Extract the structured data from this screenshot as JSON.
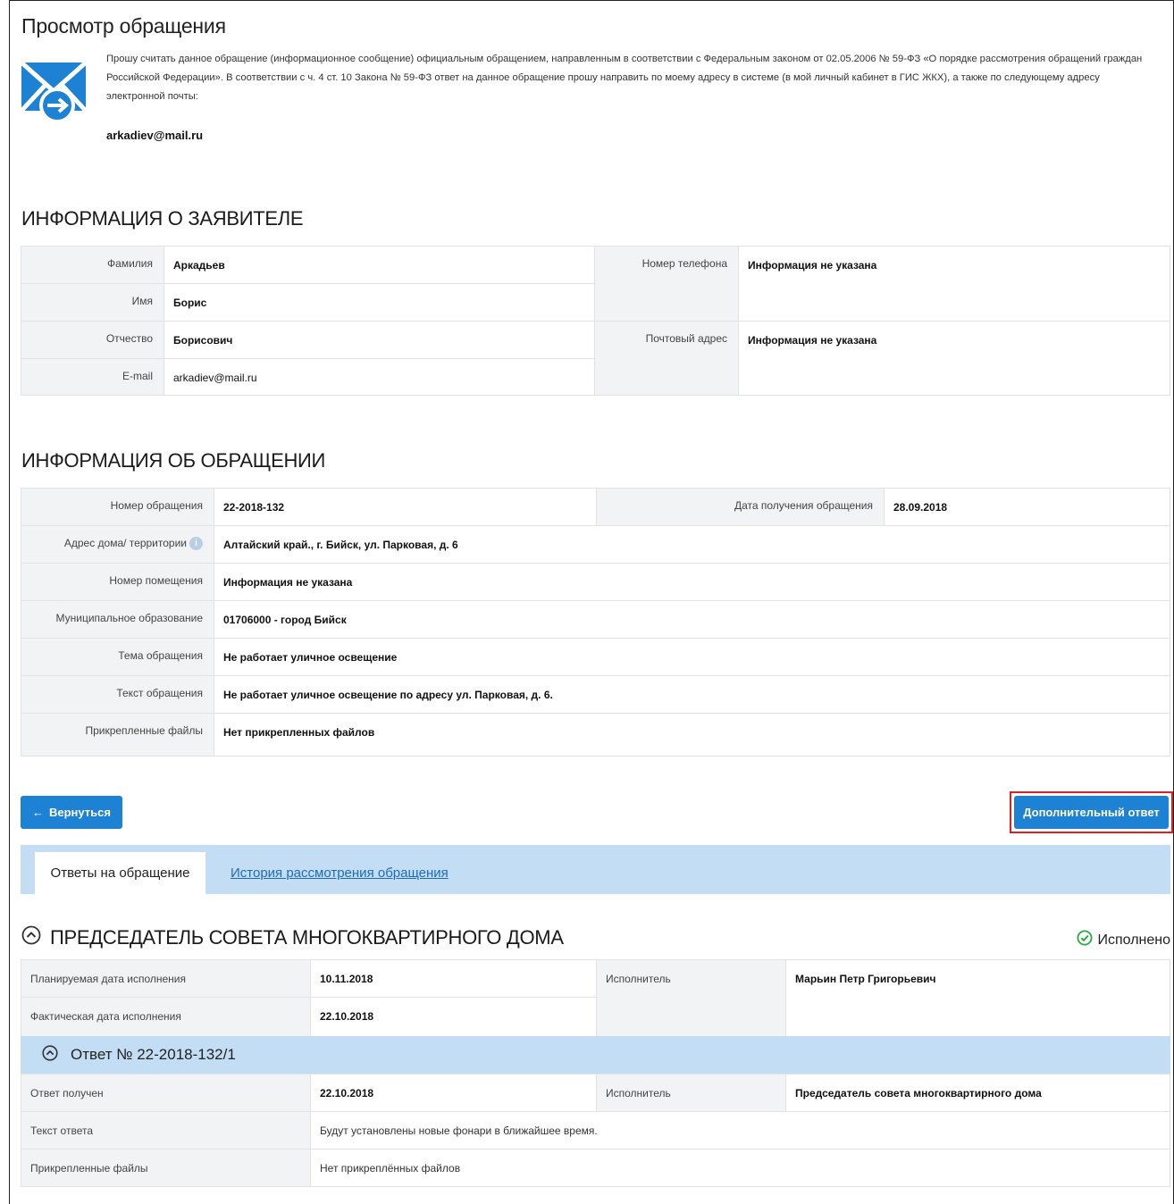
{
  "page": {
    "title": "Просмотр обращения",
    "notice_text": "Прошу считать данное обращение (информационное сообщение) официальным обращением, направленным в соответствии с Федеральным законом от 02.05.2006 № 59-ФЗ «О порядке рассмотрения обращений граждан Российской Федерации». В соответствии с ч. 4 ст. 10 Закона № 59-ФЗ ответ на данное обращение прошу направить по моему адресу в системе (в мой личный кабинет в ГИС ЖКХ), а также по следующему адресу электронной почты:",
    "notice_email": "arkadiev@mail.ru"
  },
  "applicant": {
    "section_title": "ИНФОРМАЦИЯ О ЗАЯВИТЕЛЕ",
    "surname_label": "Фамилия",
    "surname": "Аркадьев",
    "name_label": "Имя",
    "name": "Борис",
    "patronymic_label": "Отчество",
    "patronymic": "Борисович",
    "email_label": "E-mail",
    "email": "arkadiev@mail.ru",
    "phone_label": "Номер телефона",
    "phone": "Информация не указана",
    "postal_label": "Почтовый адрес",
    "postal": "Информация не указана"
  },
  "appeal": {
    "section_title": "ИНФОРМАЦИЯ ОБ ОБРАЩЕНИИ",
    "number_label": "Номер обращения",
    "number": "22-2018-132",
    "date_label": "Дата получения обращения",
    "date": "28.09.2018",
    "address_label": "Адрес дома/ территории",
    "address": "Алтайский край., г. Бийск, ул. Парковая, д. 6",
    "room_label": "Номер помещения",
    "room": "Информация не указана",
    "municipality_label": "Муниципальное образование",
    "municipality": "01706000 - город Бийск",
    "topic_label": "Тема обращения",
    "topic": "Не работает уличное освещение",
    "text_label": "Текст обращения",
    "text": "Не работает уличное освещение по адресу ул. Парковая, д. 6.",
    "files_label": "Прикрепленные файлы",
    "files": "Нет прикрепленных файлов"
  },
  "actions": {
    "back_label": "Вернуться",
    "back_arrow": "←",
    "extra_answer_label": "Дополнительный ответ"
  },
  "tabs": [
    {
      "label": "Ответы на обращение"
    },
    {
      "label": "История рассмотрения обращения"
    }
  ],
  "executor_block": {
    "title": "ПРЕДСЕДАТЕЛЬ СОВЕТА МНОГОКВАРТИРНОГО ДОМА",
    "status": "Исполнено",
    "planned_label": "Планируемая дата исполнения",
    "planned": "10.11.2018",
    "actual_label": "Фактическая дата исполнения",
    "actual": "22.10.2018",
    "executor_label": "Исполнитель",
    "executor": "Марьин Петр Григорьевич"
  },
  "answer": {
    "title": "Ответ № 22-2018-132/1",
    "received_label": "Ответ получен",
    "received": "22.10.2018",
    "executor_label": "Исполнитель",
    "executor": "Председатель совета многоквартирного дома",
    "text_label": "Текст ответа",
    "text": "Будут установлены новые фонари в ближайшее время.",
    "files_label": "Прикрепленные файлы",
    "files": "Нет прикреплённых файлов"
  },
  "icons": {
    "mail": "mail-forward-icon",
    "info": "info-icon",
    "collapse": "chevron-up-circle-icon",
    "status": "check-circle-icon"
  },
  "colors": {
    "primary": "#1d81d4",
    "tab_bar": "#c3ddf4",
    "highlight": "#e02020",
    "status": "#2aa845"
  }
}
